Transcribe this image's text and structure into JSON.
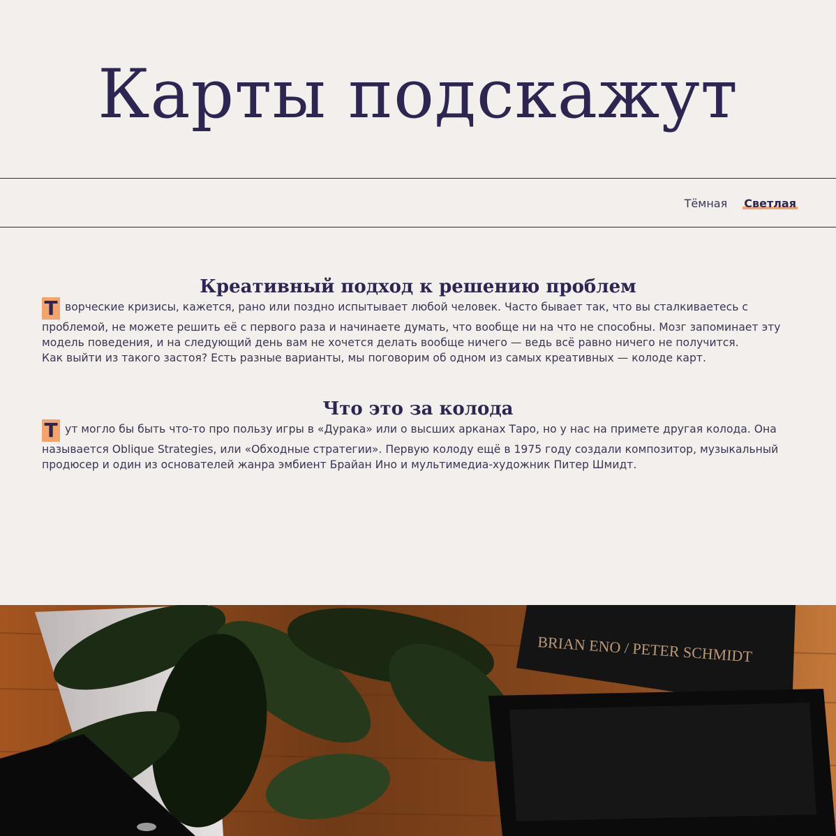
{
  "header": {
    "title": "Карты подскажут"
  },
  "theme_switcher": {
    "dark_label": "Тёмная",
    "light_label": "Светлая",
    "active": "light"
  },
  "sections": [
    {
      "title": "Креативный подход к решению проблем",
      "p1_dropcap": "Т",
      "p1_rest": "ворческие кризисы, кажется, рано или поздно испытывает любой человек. Часто бывает так, что вы сталкиваетесь с проблемой, не можете решить её с первого раза и начинаете думать, что вообще ни на что не способны. Мозг запоминает эту модель поведения, и на следующий день вам не хочется делать вообще ничего — ведь всё равно ничего не получится.",
      "p2": "Как выйти из такого застоя? Есть разные варианты, мы поговорим об одном из самых креативных — колоде карт."
    },
    {
      "title": "Что это за колода",
      "p1_dropcap": "Т",
      "p1_rest": "ут могло бы быть что-то про пользу игры в «Дурака» или о высших арканах Таро, но у нас на примете другая колода. Она называется Oblique Strategies, или «Обходные стратегии». Первую колоду ещё в 1975 году создали композитор, музыкальный продюсер и один из основателей жанра эмбиент Брайан Ино и мультимедиа-художник Питер Шмидт."
    }
  ],
  "photo": {
    "box_text": "BRIAN ENO / PETER SCHMIDT"
  },
  "colors": {
    "accent": "#f4a46a",
    "text": "#2d2651",
    "background": "#f3efec"
  }
}
